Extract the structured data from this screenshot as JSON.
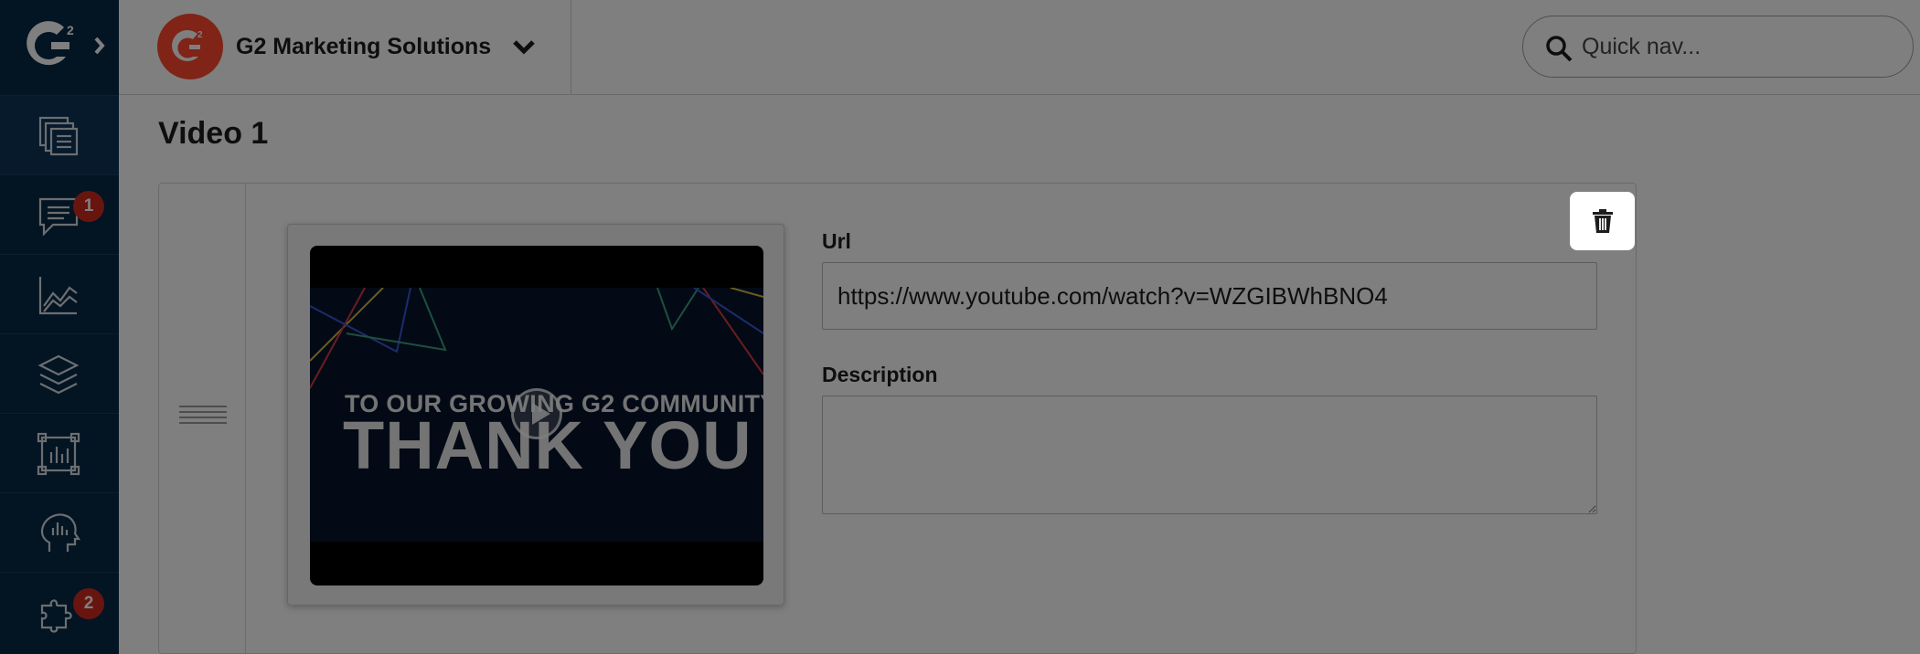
{
  "sidebar": {
    "items": [
      {
        "icon": "content-pages-icon",
        "active": true,
        "badge": ""
      },
      {
        "icon": "messages-icon",
        "active": false,
        "badge": "1"
      },
      {
        "icon": "analytics-chart-icon",
        "active": false,
        "badge": ""
      },
      {
        "icon": "layers-icon",
        "active": false,
        "badge": ""
      },
      {
        "icon": "report-frame-icon",
        "active": false,
        "badge": ""
      },
      {
        "icon": "buyer-intent-head-icon",
        "active": false,
        "badge": ""
      },
      {
        "icon": "integrations-puzzle-icon",
        "active": false,
        "badge": "2"
      }
    ]
  },
  "header": {
    "org_name": "G2 Marketing Solutions",
    "search": {
      "placeholder": "Quick nav..."
    }
  },
  "main": {
    "title": "Video 1",
    "video": {
      "thumbnail_line1": "TO OUR GROWING G2 COMMUNITY:",
      "thumbnail_line2": "THANK YOU"
    },
    "url_label": "Url",
    "url_value": "https://www.youtube.com/watch?v=WZGIBWhBNO4",
    "description_label": "Description",
    "description_value": ""
  },
  "colors": {
    "sidebar_bg": "#062846",
    "brand_red": "#ff492c",
    "badge_red": "#d12b20",
    "overlay": "rgba(0,0,0,0.5)"
  }
}
